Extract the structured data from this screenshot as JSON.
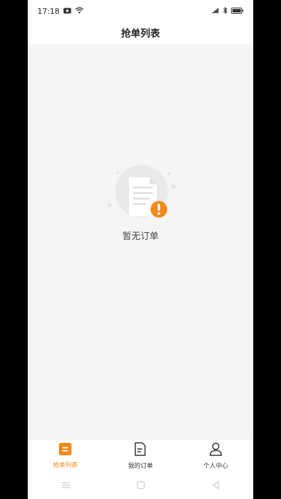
{
  "status_bar": {
    "time": "17:18",
    "left_icons": [
      "message-icon",
      "wifi-icon"
    ],
    "right_icons": [
      "signal-icon",
      "bluetooth-icon",
      "battery-icon"
    ]
  },
  "header": {
    "title": "抢单列表"
  },
  "empty_state": {
    "text": "暂无订单",
    "icon": "empty-document-icon"
  },
  "tabs": [
    {
      "label": "抢单列表",
      "icon": "list-icon",
      "active": true
    },
    {
      "label": "我的订单",
      "icon": "document-icon",
      "active": false
    },
    {
      "label": "个人中心",
      "icon": "person-icon",
      "active": false
    }
  ],
  "colors": {
    "accent": "#f08a1c",
    "background": "#f5f5f5"
  },
  "system_nav": [
    "menu-icon",
    "home-icon",
    "back-icon"
  ]
}
